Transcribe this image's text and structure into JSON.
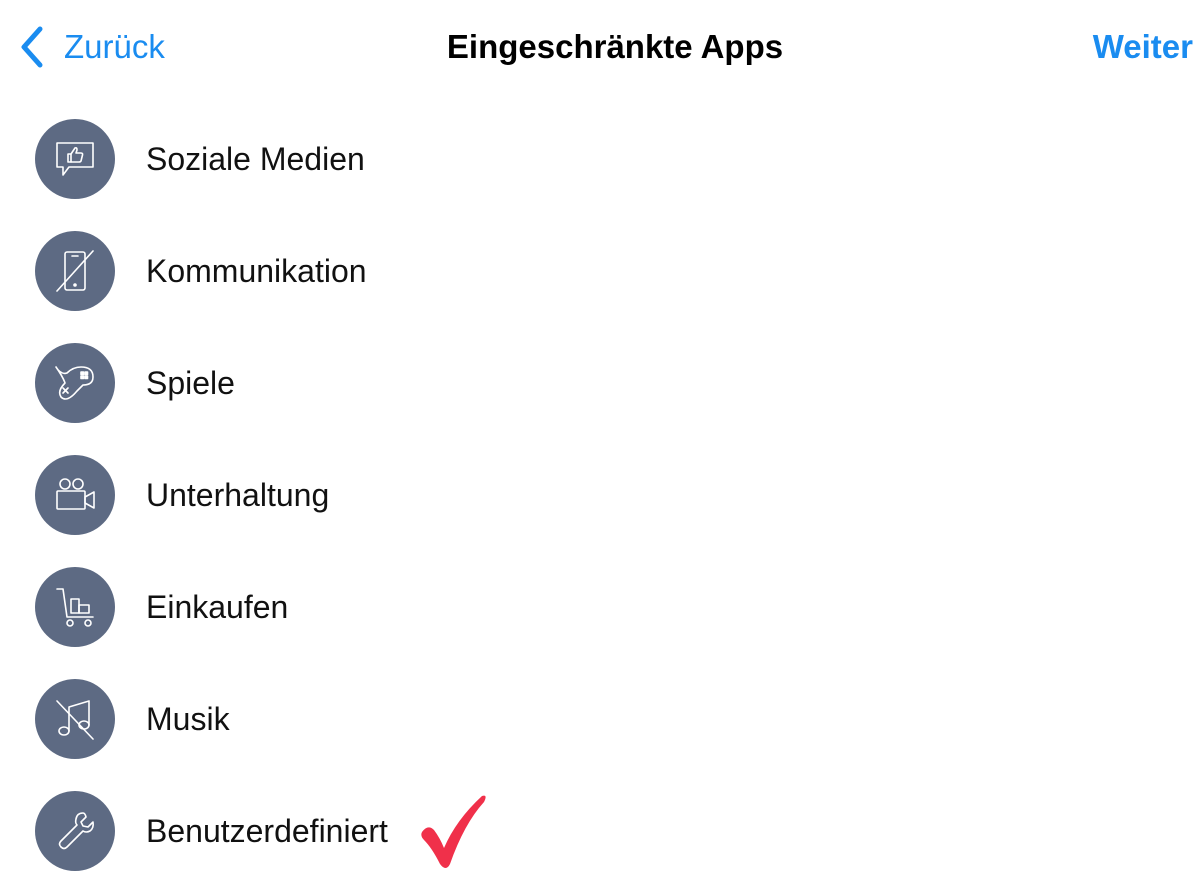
{
  "nav": {
    "back_label": "Zurück",
    "title": "Eingeschränkte Apps",
    "next_label": "Weiter"
  },
  "categories": [
    {
      "label": "Soziale Medien",
      "icon": "social-media-icon"
    },
    {
      "label": "Kommunikation",
      "icon": "communication-icon"
    },
    {
      "label": "Spiele",
      "icon": "games-icon"
    },
    {
      "label": "Unterhaltung",
      "icon": "entertainment-icon"
    },
    {
      "label": "Einkaufen",
      "icon": "shopping-icon"
    },
    {
      "label": "Musik",
      "icon": "music-icon"
    },
    {
      "label": "Benutzerdefiniert",
      "icon": "custom-wrench-icon",
      "selected": true
    }
  ],
  "colors": {
    "accent": "#1a8cf0",
    "icon_background": "#5d6a83",
    "checkmark": "#f0304a"
  }
}
